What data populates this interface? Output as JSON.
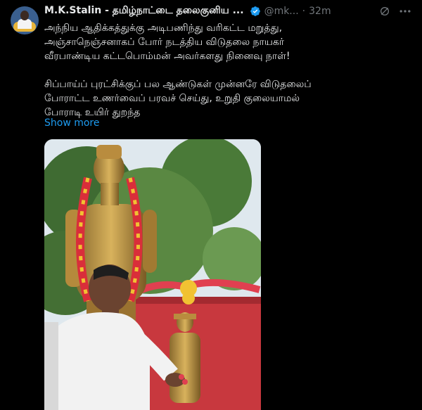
{
  "post": {
    "author_name": "M.K.Stalin - தமிழ்நாட்டை தலைகுனிய ...",
    "handle": "@mk...",
    "separator": "·",
    "time": "32m",
    "text_lines": [
      "அந்நிய ஆதிக்கத்துக்கு அடிபணிந்து வரிகட்ட மறுத்து,",
      "அஞ்சாநெஞ்சனாகப் போர் நடத்திய விடுதலை நாயகர்",
      "வீரபாண்டிய கட்டபொம்மன் அவர்களது நினைவு நாள்!",
      "",
      "சிப்பாய்ப் புரட்சிக்குப் பல ஆண்டுகள் முன்னரே விடுதலைப்",
      "போராட்ட உணர்வைப் பரவச் செய்து, உறுதி குலையாமல்",
      "போராடி உயிர் துறந்த"
    ],
    "show_more": "Show more"
  },
  "icons": {
    "verified": "verified-badge-icon",
    "grok": "grok-icon",
    "more": "more-options-icon"
  },
  "colors": {
    "background": "#000000",
    "text": "#e7e9ea",
    "muted": "#71767b",
    "link": "#1d9bf0",
    "verified": "#1d9bf0"
  }
}
